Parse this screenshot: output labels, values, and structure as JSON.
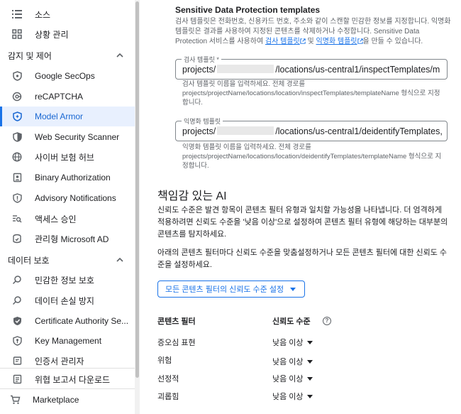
{
  "sidebar": {
    "items_top": [
      {
        "label": "소스",
        "icon": "list-icon"
      },
      {
        "label": "상황 관리",
        "icon": "grid-icon"
      }
    ],
    "section1": {
      "label": "감지 및 제어"
    },
    "items_detect": [
      {
        "label": "Google SecOps",
        "icon": "shield-icon"
      },
      {
        "label": "reCAPTCHA",
        "icon": "recaptcha-icon"
      },
      {
        "label": "Model Armor",
        "icon": "model-armor-icon"
      },
      {
        "label": "Web Security Scanner",
        "icon": "shield-half-icon"
      },
      {
        "label": "사이버 보험 허브",
        "icon": "globe-icon"
      },
      {
        "label": "Binary Authorization",
        "icon": "badge-icon"
      },
      {
        "label": "Advisory Notifications",
        "icon": "shield-info-icon"
      },
      {
        "label": "액세스 승인",
        "icon": "search-list-icon"
      },
      {
        "label": "관리형 Microsoft AD",
        "icon": "ad-icon"
      }
    ],
    "section2": {
      "label": "데이터 보호"
    },
    "items_data": [
      {
        "label": "민감한 정보 보호",
        "icon": "search-icon"
      },
      {
        "label": "데이터 손실 방지",
        "icon": "search-icon"
      },
      {
        "label": "Certificate Authority Se...",
        "icon": "certificate-icon"
      },
      {
        "label": "Key Management",
        "icon": "key-shield-icon"
      },
      {
        "label": "인증서 관리자",
        "icon": "cert-manager-icon"
      }
    ],
    "items_bottom": [
      {
        "label": "위협 보고서 다운로드",
        "icon": "report-icon"
      },
      {
        "label": "Marketplace",
        "icon": "cart-icon"
      }
    ]
  },
  "main": {
    "tpl_title": "Sensitive Data Protection templates",
    "tpl_desc_1": "검사 템플릿은 전화번호, 신용카드 번호, 주소와 같이 스캔할 민감한 정보를 지정합니다. 익명화 템플릿은 결과를 사용하여 지정된 콘텐츠를 삭제하거나 수정합니다. Sensitive Data Protection 서비스를 사용하여 ",
    "tpl_link_1": "검사 템플릿",
    "tpl_desc_2": " 및 ",
    "tpl_link_2": "익명화 템플릿",
    "tpl_desc_3": "을 만들 수 있습니다.",
    "inspect": {
      "label": "검사 템플릿 *",
      "prefix": "projects/",
      "suffix": "/locations/us-central1/inspectTemplates/m",
      "hint": "검사 템플릿 이름을 입력하세요. 전체 경로를 projects/projectName/locations/location/inspectTemplates/templateName 형식으로 지정합니다."
    },
    "deidentify": {
      "label": "익명화 템플릿",
      "prefix": "projects/",
      "suffix": "/locations/us-central1/deidentifyTemplates,",
      "hint": "익명화 템플릿 이름을 입력하세요. 전체 경로를 projects/projectName/locations/location/deidentifyTemplates/templateName 형식으로 지정합니다."
    },
    "ai_heading": "책임감 있는 AI",
    "ai_para1": "신뢰도 수준은 발견 항목이 콘텐츠 필터 유형과 일치할 가능성을 나타냅니다. 더 엄격하게 적용하려면 신뢰도 수준을 '낮음 이상'으로 설정하여 콘텐츠 필터 유형에 해당하는 대부분의 콘텐츠를 탐지하세요.",
    "ai_para2": "아래의 콘텐츠 필터마다 신뢰도 수준을 맞춤설정하거나 모든 콘텐츠 필터에 대한 신뢰도 수준을 설정하세요.",
    "set_all_button": "모든 콘텐츠 필터의 신뢰도 수준 설정",
    "table": {
      "col_filter": "콘텐츠 필터",
      "col_level": "신뢰도 수준",
      "rows": [
        {
          "name": "증오심 표현",
          "level": "낮음 이상"
        },
        {
          "name": "위험",
          "level": "낮음 이상"
        },
        {
          "name": "선정적",
          "level": "낮음 이상"
        },
        {
          "name": "괴롭힘",
          "level": "낮음 이상"
        }
      ]
    }
  },
  "colors": {
    "accent": "#1a73e8",
    "active_bg": "#e8f0fe"
  }
}
